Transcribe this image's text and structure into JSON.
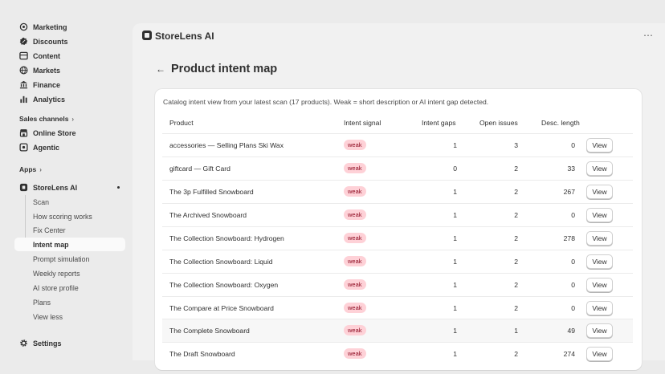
{
  "sidebar": {
    "items": [
      {
        "label": "Marketing",
        "icon": "target-icon"
      },
      {
        "label": "Discounts",
        "icon": "discount-icon"
      },
      {
        "label": "Content",
        "icon": "content-icon"
      },
      {
        "label": "Markets",
        "icon": "globe-icon"
      },
      {
        "label": "Finance",
        "icon": "bank-icon"
      },
      {
        "label": "Analytics",
        "icon": "bar-chart-icon"
      }
    ],
    "sales_channels_label": "Sales channels",
    "channels": [
      {
        "label": "Online Store",
        "icon": "store-icon"
      },
      {
        "label": "Agentic",
        "icon": "agentic-icon"
      }
    ],
    "apps_label": "Apps",
    "app": {
      "label": "StoreLens AI",
      "icon": "app-icon"
    },
    "app_subitems": [
      {
        "label": "Scan"
      },
      {
        "label": "How scoring works"
      },
      {
        "label": "Fix Center"
      },
      {
        "label": "Intent map",
        "active": true
      },
      {
        "label": "Prompt simulation"
      },
      {
        "label": "Weekly reports"
      },
      {
        "label": "AI store profile"
      },
      {
        "label": "Plans"
      },
      {
        "label": "View less"
      }
    ],
    "settings_label": "Settings"
  },
  "app_bar": {
    "title": "StoreLens AI",
    "more": "⋯"
  },
  "page": {
    "back": "←",
    "title": "Product intent map"
  },
  "card": {
    "description": "Catalog intent view from your latest scan (17 products). Weak = short description or AI intent gap detected.",
    "columns": {
      "product": "Product",
      "intent_signal": "Intent signal",
      "intent_gaps": "Intent gaps",
      "open_issues": "Open issues",
      "desc_length": "Desc. length"
    },
    "view_label": "View",
    "rows": [
      {
        "product": "accessories — Selling Plans Ski Wax",
        "signal": "weak",
        "gaps": "1",
        "issues": "3",
        "length": "0"
      },
      {
        "product": "giftcard — Gift Card",
        "signal": "weak",
        "gaps": "0",
        "issues": "2",
        "length": "33"
      },
      {
        "product": "The 3p Fulfilled Snowboard",
        "signal": "weak",
        "gaps": "1",
        "issues": "2",
        "length": "267"
      },
      {
        "product": "The Archived Snowboard",
        "signal": "weak",
        "gaps": "1",
        "issues": "2",
        "length": "0"
      },
      {
        "product": "The Collection Snowboard: Hydrogen",
        "signal": "weak",
        "gaps": "1",
        "issues": "2",
        "length": "278"
      },
      {
        "product": "The Collection Snowboard: Liquid",
        "signal": "weak",
        "gaps": "1",
        "issues": "2",
        "length": "0"
      },
      {
        "product": "The Collection Snowboard: Oxygen",
        "signal": "weak",
        "gaps": "1",
        "issues": "2",
        "length": "0"
      },
      {
        "product": "The Compare at Price Snowboard",
        "signal": "weak",
        "gaps": "1",
        "issues": "2",
        "length": "0"
      },
      {
        "product": "The Complete Snowboard",
        "signal": "weak",
        "gaps": "1",
        "issues": "1",
        "length": "49"
      },
      {
        "product": "The Draft Snowboard",
        "signal": "weak",
        "gaps": "1",
        "issues": "2",
        "length": "274"
      }
    ]
  },
  "colors": {
    "badge_bg": "#fed1d7",
    "badge_text": "#8e0b21",
    "sidebar_bg": "#ebebeb",
    "panel_bg": "#f1f1f1"
  }
}
